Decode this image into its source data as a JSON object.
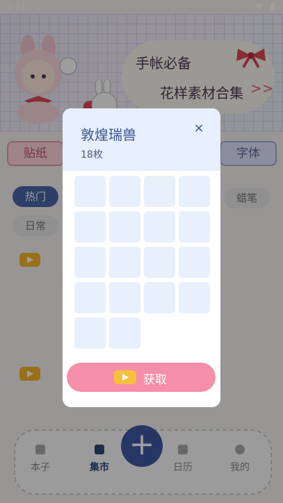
{
  "status_bar": {
    "time": "3:44"
  },
  "banner": {
    "title_line1": "手帐必备",
    "title_line2": "花样素材合集",
    "arrow": ">>"
  },
  "tabs": {
    "paper": "贴纸",
    "font": "字体"
  },
  "categories": [
    {
      "label": "热门",
      "selected": true
    },
    {
      "label": "日常",
      "selected": false
    },
    {
      "label": "蜡笔",
      "selected": false
    }
  ],
  "bottom_nav": {
    "notebook": "本子",
    "market": "集市",
    "calendar": "日历",
    "me": "我的"
  },
  "dialog": {
    "title": "敦煌瑞兽",
    "count": "18枚",
    "close": "×",
    "get_button": "获取",
    "sticker_slots": 18
  },
  "colors": {
    "accent": "#3f5aa4",
    "button_pink": "#f58ea8",
    "dialog_header": "#e7eefc",
    "video_icon": "#f5b52a"
  }
}
